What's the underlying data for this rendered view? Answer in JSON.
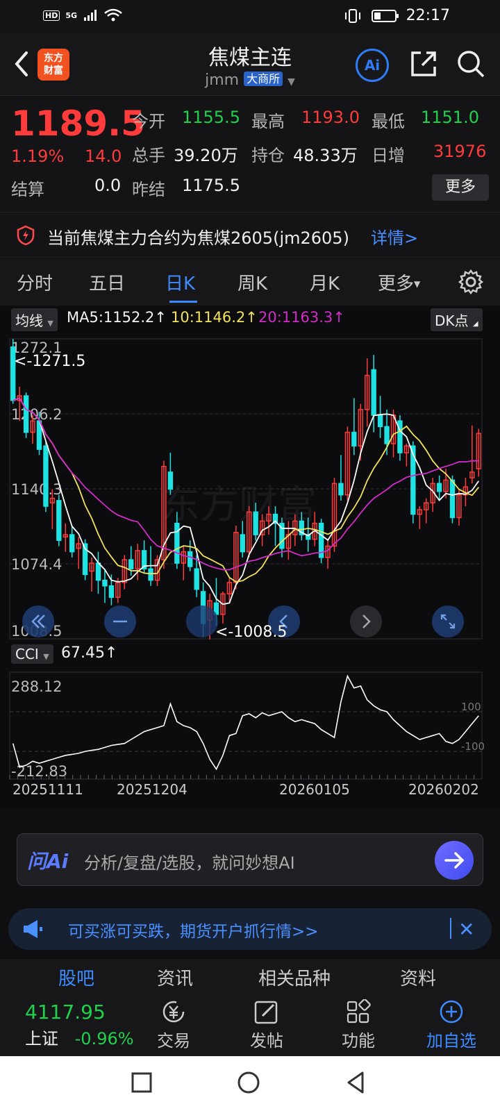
{
  "status_bar": {
    "hd": "HD",
    "net": "5G",
    "time": "22:17"
  },
  "header": {
    "logo_line1": "东方",
    "logo_line2": "财富",
    "title": "焦煤主连",
    "code": "jmm",
    "exchange": "大商所",
    "ai_label": "Ai"
  },
  "quote": {
    "price": "1189.5",
    "change_pct": "1.19%",
    "change_val": "14.0",
    "open_label": "今开",
    "open": "1155.5",
    "high_label": "最高",
    "high": "1193.0",
    "low_label": "最低",
    "low": "1151.0",
    "volume_label": "总手",
    "volume": "39.20万",
    "oi_label": "持仓",
    "oi": "48.33万",
    "daily_inc_label": "日增",
    "daily_inc": "31976",
    "settle_label": "结算",
    "settle": "0.0",
    "prev_settle_label": "昨结",
    "prev_settle": "1175.5",
    "more_button": "更多"
  },
  "notice": {
    "text": "当前焦煤主力合约为焦煤2605(jm2605)",
    "link": "详情>"
  },
  "tabs": [
    "分时",
    "五日",
    "日K",
    "周K",
    "月K",
    "更多"
  ],
  "active_tab": "日K",
  "indicator": {
    "selector": "均线",
    "ma5": "MA5:1152.2↑",
    "ma10": "10:1146.2↑",
    "ma20": "20:1163.3↑",
    "dk_button": "DK点",
    "cci_selector": "CCI",
    "cci_value": "67.45↑"
  },
  "colors": {
    "up": "#ff3b3b",
    "down": "#1fe3e3",
    "ma5": "#ffffff",
    "ma10": "#f2e35c",
    "ma20": "#d12cc8",
    "accent": "#3d8cff"
  },
  "chart_data": {
    "type": "candlestick",
    "y_labels": [
      "1272.1",
      "1206.2",
      "1140.3",
      "1074.4",
      "1008.5"
    ],
    "ylim": [
      1008.5,
      1272.1
    ],
    "max_marker": "<-1271.5",
    "min_marker": "<-1008.5",
    "x_labels": [
      "20251111",
      "20251204",
      "20260105",
      "20260202"
    ],
    "candles": [
      [
        1265,
        1272,
        1215,
        1218
      ],
      [
        1218,
        1230,
        1200,
        1222
      ],
      [
        1222,
        1225,
        1185,
        1190
      ],
      [
        1190,
        1205,
        1180,
        1200
      ],
      [
        1200,
        1208,
        1170,
        1175
      ],
      [
        1178,
        1182,
        1120,
        1125
      ],
      [
        1128,
        1140,
        1105,
        1132
      ],
      [
        1130,
        1135,
        1090,
        1095
      ],
      [
        1098,
        1110,
        1085,
        1100
      ],
      [
        1100,
        1108,
        1080,
        1085
      ],
      [
        1088,
        1098,
        1070,
        1092
      ],
      [
        1092,
        1096,
        1060,
        1065
      ],
      [
        1068,
        1080,
        1050,
        1075
      ],
      [
        1075,
        1085,
        1048,
        1060
      ],
      [
        1060,
        1070,
        1040,
        1055
      ],
      [
        1055,
        1065,
        1038,
        1045
      ],
      [
        1045,
        1062,
        1040,
        1058
      ],
      [
        1058,
        1082,
        1052,
        1078
      ],
      [
        1078,
        1090,
        1064,
        1070
      ],
      [
        1070,
        1092,
        1060,
        1086
      ],
      [
        1086,
        1095,
        1066,
        1070
      ],
      [
        1070,
        1090,
        1055,
        1060
      ],
      [
        1060,
        1082,
        1055,
        1078
      ],
      [
        1078,
        1165,
        1070,
        1160
      ],
      [
        1155,
        1172,
        1135,
        1140
      ],
      [
        1110,
        1120,
        1070,
        1075
      ],
      [
        1075,
        1090,
        1060,
        1085
      ],
      [
        1085,
        1095,
        1068,
        1072
      ],
      [
        1070,
        1082,
        1045,
        1052
      ],
      [
        1050,
        1058,
        1010,
        1022
      ],
      [
        1025,
        1048,
        1008,
        1042
      ],
      [
        1040,
        1062,
        1020,
        1030
      ],
      [
        1030,
        1050,
        1022,
        1048
      ],
      [
        1048,
        1062,
        1040,
        1058
      ],
      [
        1058,
        1108,
        1052,
        1102
      ],
      [
        1100,
        1112,
        1080,
        1085
      ],
      [
        1085,
        1125,
        1080,
        1120
      ],
      [
        1120,
        1128,
        1095,
        1100
      ],
      [
        1100,
        1118,
        1090,
        1112
      ],
      [
        1112,
        1125,
        1100,
        1118
      ],
      [
        1118,
        1125,
        1090,
        1110
      ],
      [
        1110,
        1115,
        1080,
        1088
      ],
      [
        1088,
        1112,
        1078,
        1100
      ],
      [
        1100,
        1118,
        1090,
        1112
      ],
      [
        1112,
        1120,
        1095,
        1100
      ],
      [
        1100,
        1115,
        1085,
        1096
      ],
      [
        1096,
        1120,
        1090,
        1110
      ],
      [
        1110,
        1114,
        1075,
        1080
      ],
      [
        1080,
        1095,
        1070,
        1090
      ],
      [
        1090,
        1150,
        1085,
        1145
      ],
      [
        1145,
        1170,
        1130,
        1135
      ],
      [
        1135,
        1195,
        1130,
        1190
      ],
      [
        1190,
        1220,
        1170,
        1178
      ],
      [
        1178,
        1215,
        1165,
        1210
      ],
      [
        1210,
        1255,
        1195,
        1240
      ],
      [
        1245,
        1258,
        1190,
        1205
      ],
      [
        1205,
        1222,
        1185,
        1195
      ],
      [
        1195,
        1210,
        1170,
        1180
      ],
      [
        1180,
        1210,
        1168,
        1205
      ],
      [
        1200,
        1205,
        1165,
        1172
      ],
      [
        1172,
        1180,
        1160,
        1178
      ],
      [
        1178,
        1182,
        1110,
        1118
      ],
      [
        1118,
        1125,
        1105,
        1122
      ],
      [
        1122,
        1132,
        1110,
        1128
      ],
      [
        1128,
        1150,
        1120,
        1145
      ],
      [
        1145,
        1152,
        1130,
        1138
      ],
      [
        1138,
        1158,
        1132,
        1148
      ],
      [
        1148,
        1152,
        1110,
        1115
      ],
      [
        1115,
        1140,
        1108,
        1135
      ],
      [
        1135,
        1150,
        1125,
        1142
      ],
      [
        1150,
        1196,
        1145,
        1155
      ],
      [
        1158,
        1193,
        1151,
        1189
      ]
    ],
    "cci_labels": [
      "288.12",
      "-212.83"
    ],
    "cci_ref_labels": [
      "100",
      "-100"
    ],
    "cci_ylim": [
      -240,
      300
    ],
    "cci": [
      -60,
      -180,
      -170,
      -150,
      -160,
      -150,
      -140,
      -130,
      -120,
      -115,
      -110,
      -100,
      -95,
      -90,
      -80,
      -70,
      -65,
      -60,
      -40,
      -20,
      0,
      10,
      20,
      30,
      140,
      50,
      30,
      20,
      0,
      -60,
      -140,
      -190,
      -120,
      -20,
      -10,
      80,
      90,
      70,
      95,
      80,
      90,
      100,
      70,
      50,
      60,
      50,
      40,
      10,
      -10,
      -30,
      150,
      280,
      220,
      230,
      160,
      130,
      110,
      100,
      60,
      30,
      0,
      -20,
      -40,
      -30,
      -20,
      -10,
      -50,
      -60,
      -40,
      0,
      40,
      80
    ]
  },
  "ask_ai": {
    "brand": "问Ai",
    "placeholder": "分析/复盘/选股，就问妙想AI"
  },
  "promo": {
    "text": "可买涨可买跌，期货开户抓行情>>"
  },
  "sub_tabs": [
    "股吧",
    "资讯",
    "相关品种",
    "资料"
  ],
  "index": {
    "name": "上证",
    "value": "4117.95",
    "change": "-0.96%"
  },
  "toolbar": {
    "trade": "交易",
    "post": "发帖",
    "func": "功能",
    "watch": "加自选"
  }
}
